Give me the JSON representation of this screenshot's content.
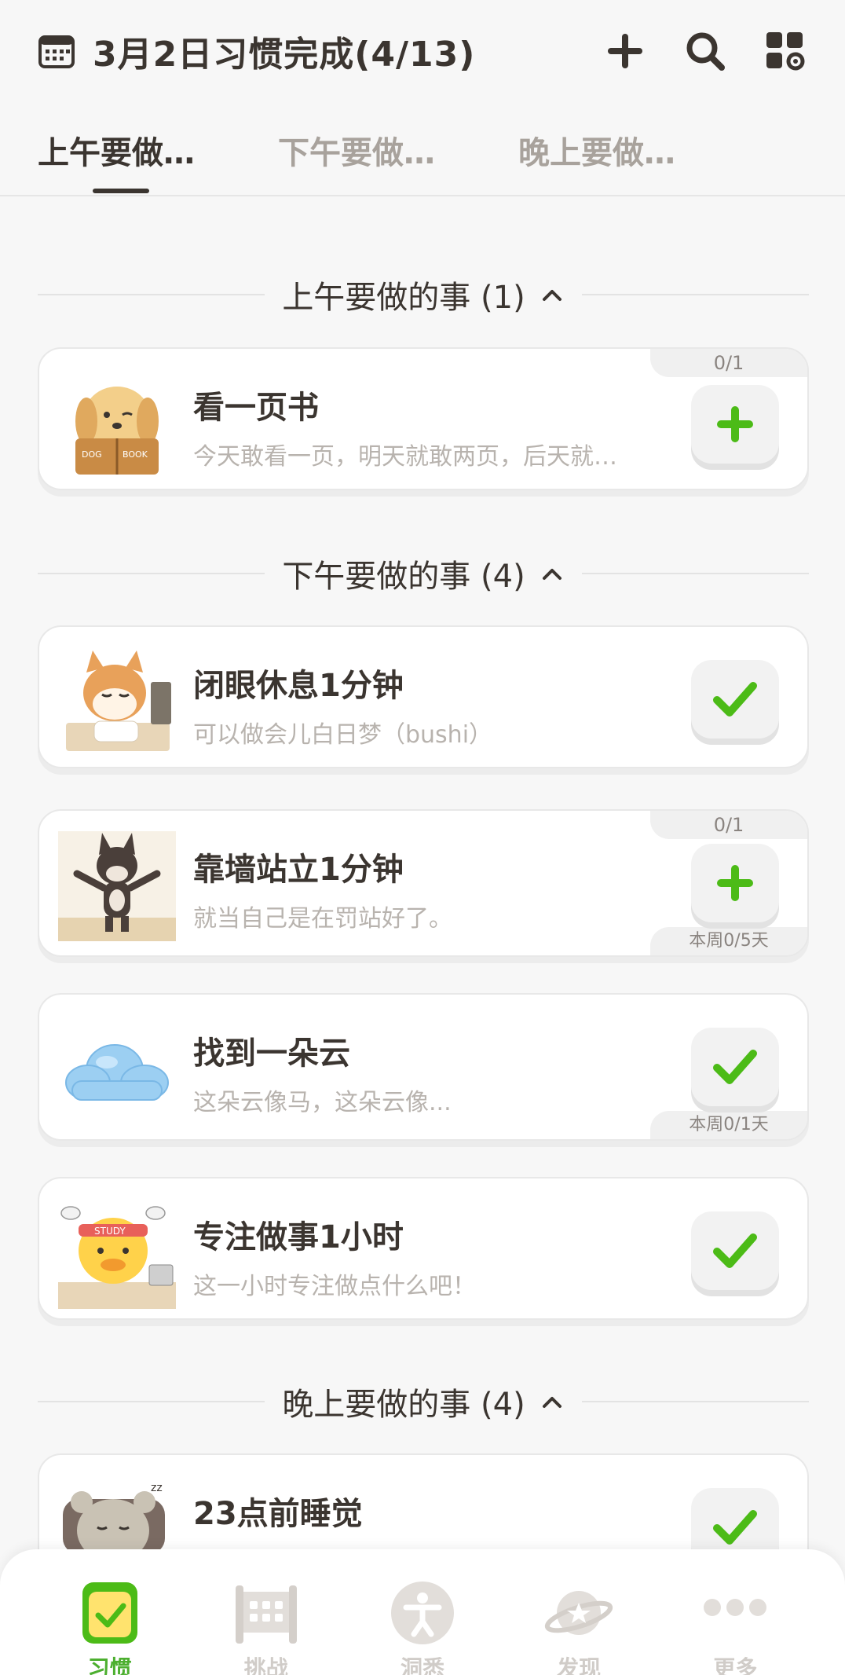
{
  "header": {
    "title": "3月2日习惯完成(4/13)",
    "icons": [
      "calendar-icon",
      "plus-icon",
      "search-icon",
      "grid-settings-icon"
    ]
  },
  "tabs": [
    {
      "label": "上午要做…",
      "active": true
    },
    {
      "label": "下午要做…",
      "active": false
    },
    {
      "label": "晚上要做…",
      "active": false
    }
  ],
  "sections": [
    {
      "title": "上午要做的事 (1)",
      "cards": [
        {
          "title": "看一页书",
          "desc": "今天敢看一页，明天就敢两页，后天就…",
          "button": "plus",
          "top_tag": "0/1",
          "bottom_tag": "",
          "image": "dog-reading-book"
        }
      ]
    },
    {
      "title": "下午要做的事 (4)",
      "cards": [
        {
          "title": "闭眼休息1分钟",
          "desc": "可以做会儿白日梦（bushi）",
          "button": "check",
          "top_tag": "",
          "bottom_tag": "",
          "image": "shiba-resting"
        },
        {
          "title": "靠墙站立1分钟",
          "desc": "就当自己是在罚站好了。",
          "button": "plus",
          "top_tag": "0/1",
          "bottom_tag": "本周0/5天",
          "image": "wolf-standing"
        },
        {
          "title": "找到一朵云",
          "desc": "这朵云像马，这朵云像...",
          "button": "check",
          "top_tag": "",
          "bottom_tag": "本周0/1天",
          "image": "cloud"
        },
        {
          "title": "专注做事1小时",
          "desc": "这一小时专注做点什么吧！",
          "button": "check",
          "top_tag": "",
          "bottom_tag": "",
          "image": "duck-studying"
        }
      ]
    },
    {
      "title": "晚上要做的事 (4)",
      "cards": [
        {
          "title": "23点前睡觉",
          "desc": "",
          "button": "check",
          "top_tag": "",
          "bottom_tag": "",
          "image": "bear-sleeping"
        }
      ]
    }
  ],
  "nav": [
    {
      "label": "习惯",
      "icon": "habit-check-icon",
      "active": true
    },
    {
      "label": "挑战",
      "icon": "challenge-icon",
      "active": false
    },
    {
      "label": "洞悉",
      "icon": "insight-person-icon",
      "active": false
    },
    {
      "label": "发现",
      "icon": "planet-discover-icon",
      "active": false
    },
    {
      "label": "更多",
      "icon": "more-dots-icon",
      "active": false
    }
  ],
  "colors": {
    "accent": "#4cbb17",
    "text": "#3b3530",
    "muted": "#b8b3ae"
  }
}
